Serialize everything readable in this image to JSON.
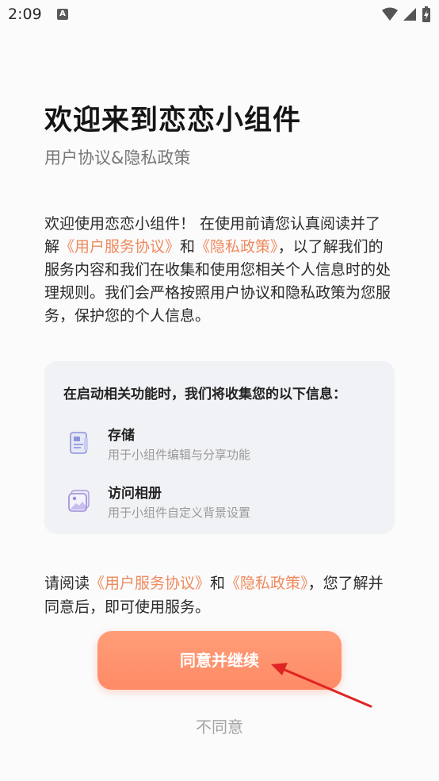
{
  "status_bar": {
    "time": "2:09",
    "notification_badge": "A"
  },
  "header": {
    "title": "欢迎来到恋恋小组件",
    "subtitle": "用户协议&隐私政策"
  },
  "intro": {
    "part1": "欢迎使用恋恋小组件！ 在使用前请您认真阅读并了解",
    "link1": "《用户服务协议》",
    "part2": "和",
    "link2": "《隐私政策》",
    "part3": "，以了解我们的服务内容和我们在收集和使用您相关个人信息时的处理规则。我们会严格按照用户协议和隐私政策为您服务，保护您的个人信息。"
  },
  "permissions_card": {
    "title": "在启动相关功能时，我们将收集您的以下信息：",
    "items": [
      {
        "icon": "storage-icon",
        "title": "存储",
        "desc": "用于小组件编辑与分享功能"
      },
      {
        "icon": "album-icon",
        "title": "访问相册",
        "desc": "用于小组件自定义背景设置"
      }
    ]
  },
  "notice": {
    "part1": "请阅读",
    "link1": "《用户服务协议》",
    "part2": "和",
    "link2": "《隐私政策》",
    "part3": "，您了解并同意后，即可使用服务。"
  },
  "actions": {
    "agree_label": "同意并继续",
    "disagree_label": "不同意"
  },
  "colors": {
    "accent": "#f08a5d",
    "button": "#ff8f6b",
    "annotation_arrow": "#e02424"
  }
}
